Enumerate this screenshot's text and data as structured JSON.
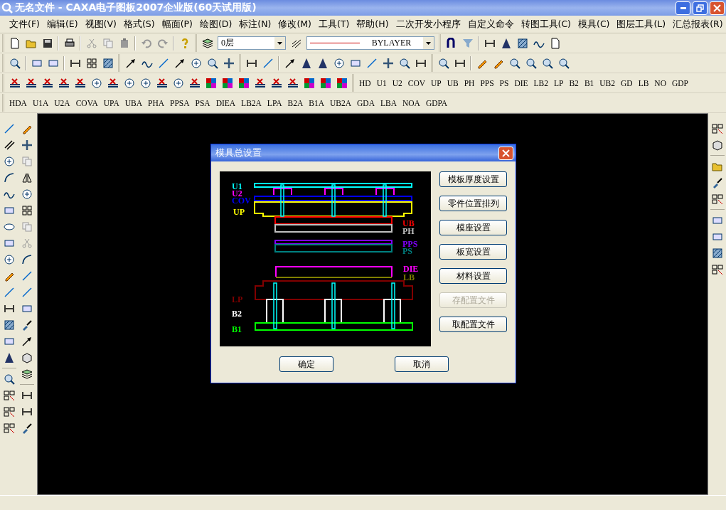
{
  "window": {
    "title": "无名文件 - CAXA电子图板2007企业版(60天试用版)"
  },
  "menu": [
    {
      "label": "文件(F)"
    },
    {
      "label": "编辑(E)"
    },
    {
      "label": "视图(V)"
    },
    {
      "label": "格式(S)"
    },
    {
      "label": "幅面(P)"
    },
    {
      "label": "绘图(D)"
    },
    {
      "label": "标注(N)"
    },
    {
      "label": "修改(M)"
    },
    {
      "label": "工具(T)"
    },
    {
      "label": "帮助(H)"
    },
    {
      "label": "二次开发小程序"
    },
    {
      "label": "自定义命令"
    },
    {
      "label": "转图工具(C)"
    },
    {
      "label": "模具(C)"
    },
    {
      "label": "图层工具(L)"
    },
    {
      "label": "汇总报表(R)"
    }
  ],
  "toolbar": {
    "layer": "0层",
    "linetype": "BYLAYER"
  },
  "part_buttons": [
    "HD",
    "U1",
    "U2",
    "COV",
    "UP",
    "UB",
    "PH",
    "PPS",
    "PS",
    "DIE",
    "LB2",
    "LP",
    "B2",
    "B1",
    "UB2",
    "GD",
    "LB",
    "NO",
    "GDP"
  ],
  "part_buttons_a": [
    "HDA",
    "U1A",
    "U2A",
    "COVA",
    "UPA",
    "UBA",
    "PHA",
    "PPSA",
    "PSA",
    "DIEA",
    "LB2A",
    "LPA",
    "B2A",
    "B1A",
    "UB2A",
    "GDA",
    "LBA",
    "NOA",
    "GDPA"
  ],
  "dialog": {
    "title": "模具总设置",
    "preview_labels": [
      {
        "text": "U1",
        "color": "#00ffff"
      },
      {
        "text": "U2",
        "color": "#ff00ff"
      },
      {
        "text": "COV",
        "color": "#0000ff"
      },
      {
        "text": "UP",
        "color": "#ffff00"
      },
      {
        "text": "UB",
        "color": "#ff0000"
      },
      {
        "text": "PH",
        "color": "#c0c0c0"
      },
      {
        "text": "PPS",
        "color": "#8000ff"
      },
      {
        "text": "PS",
        "color": "#008080"
      },
      {
        "text": "DIE",
        "color": "#ff00ff"
      },
      {
        "text": "LB",
        "color": "#808000"
      },
      {
        "text": "LP",
        "color": "#800000"
      },
      {
        "text": "B2",
        "color": "#ffffff"
      },
      {
        "text": "B1",
        "color": "#00ff00"
      }
    ],
    "buttons": [
      {
        "label": "模板厚度设置",
        "disabled": false
      },
      {
        "label": "零件位置排列",
        "disabled": false
      },
      {
        "label": "模座设置",
        "disabled": false
      },
      {
        "label": "板宽设置",
        "disabled": false
      },
      {
        "label": "材料设置",
        "disabled": false
      },
      {
        "label": "存配置文件",
        "disabled": true
      },
      {
        "label": "取配置文件",
        "disabled": false
      }
    ],
    "ok": "确定",
    "cancel": "取消"
  }
}
